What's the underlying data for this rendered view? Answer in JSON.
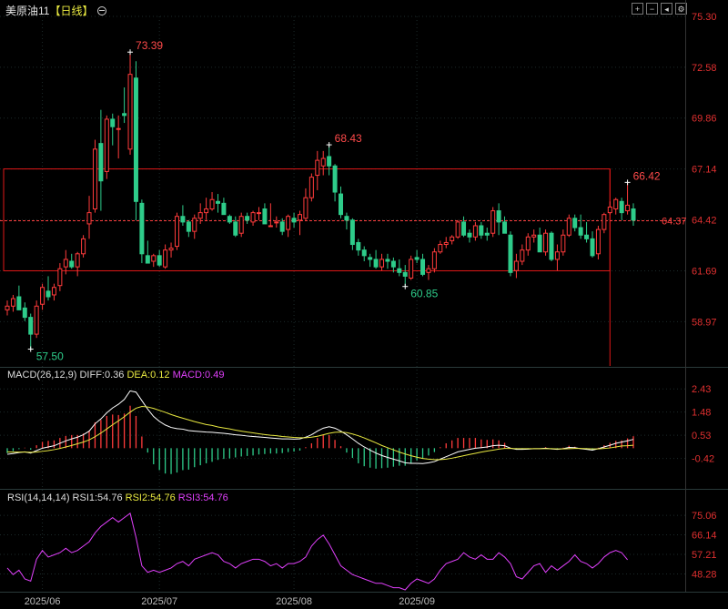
{
  "header": {
    "symbol": "美原油11",
    "period": "【日线】",
    "toggle_icon": "circle-minus-icon",
    "toolbar_icons": [
      "grid-plus-icon",
      "grid-minus-icon",
      "back-arrow-icon",
      "settings-icon"
    ]
  },
  "colors": {
    "up": "#ff3b3b",
    "down": "#2ecc8a",
    "ma_white": "#ffffff",
    "ma_yellow": "#e8e840",
    "rsi": "#e040fb",
    "box": "#e01818",
    "grid": "#1c2a2a"
  },
  "chart_data": [
    {
      "type": "candlestick",
      "title": "美原油11 【日线】",
      "y_ticks": [
        "75.30",
        "72.58",
        "69.86",
        "67.14",
        "64.42",
        "61.69",
        "58.97"
      ],
      "ylim": [
        56.6,
        75.3
      ],
      "x_ticks": [
        {
          "i": 6,
          "label": "2025/06"
        },
        {
          "i": 26,
          "label": "2025/07"
        },
        {
          "i": 49,
          "label": "2025/08"
        },
        {
          "i": 70,
          "label": "2025/09"
        }
      ],
      "ohlc": [
        [
          59.6,
          60.1,
          59.3,
          59.8
        ],
        [
          59.8,
          60.4,
          59.5,
          60.2
        ],
        [
          60.3,
          60.9,
          59.7,
          59.6
        ],
        [
          59.7,
          60.0,
          59.0,
          59.2
        ],
        [
          59.2,
          59.4,
          57.5,
          58.3
        ],
        [
          58.3,
          60.1,
          58.1,
          59.8
        ],
        [
          59.9,
          61.0,
          59.6,
          60.8
        ],
        [
          60.6,
          61.4,
          60.1,
          60.3
        ],
        [
          60.4,
          61.0,
          60.1,
          60.8
        ],
        [
          60.9,
          62.1,
          60.6,
          61.8
        ],
        [
          61.9,
          62.8,
          61.5,
          62.3
        ],
        [
          62.2,
          62.6,
          61.8,
          61.9
        ],
        [
          61.9,
          62.7,
          61.4,
          62.6
        ],
        [
          62.6,
          63.6,
          62.4,
          63.4
        ],
        [
          64.2,
          65.7,
          63.4,
          64.8
        ],
        [
          65.0,
          68.7,
          64.8,
          68.2
        ],
        [
          68.5,
          70.3,
          64.9,
          66.5
        ],
        [
          67.0,
          70.0,
          66.6,
          69.8
        ],
        [
          69.8,
          70.1,
          68.4,
          69.4
        ],
        [
          69.3,
          70.0,
          67.7,
          69.3
        ],
        [
          70.1,
          71.5,
          69.6,
          70.0
        ],
        [
          68.2,
          73.39,
          67.9,
          72.2
        ],
        [
          72.0,
          72.9,
          64.4,
          65.4
        ],
        [
          65.3,
          65.5,
          62.1,
          62.6
        ],
        [
          62.5,
          63.3,
          62.1,
          62.1
        ],
        [
          62.2,
          62.6,
          61.9,
          62.5
        ],
        [
          62.5,
          62.8,
          61.9,
          62.0
        ],
        [
          61.9,
          63.1,
          61.8,
          62.8
        ],
        [
          62.8,
          63.2,
          62.4,
          62.9
        ],
        [
          63.0,
          64.8,
          62.8,
          64.6
        ],
        [
          64.6,
          65.2,
          64.1,
          64.3
        ],
        [
          64.3,
          64.4,
          63.5,
          63.8
        ],
        [
          63.8,
          64.7,
          63.4,
          64.5
        ],
        [
          64.5,
          65.3,
          64.2,
          64.8
        ],
        [
          64.8,
          65.6,
          64.4,
          65.0
        ],
        [
          65.0,
          65.9,
          64.9,
          65.5
        ],
        [
          65.4,
          65.8,
          64.8,
          65.3
        ],
        [
          65.3,
          65.6,
          64.8,
          64.7
        ],
        [
          64.6,
          64.7,
          64.2,
          64.3
        ],
        [
          64.3,
          64.6,
          63.5,
          63.6
        ],
        [
          63.7,
          64.8,
          63.5,
          64.6
        ],
        [
          64.6,
          64.8,
          64.2,
          64.4
        ],
        [
          64.3,
          64.9,
          64.1,
          64.8
        ],
        [
          64.8,
          65.1,
          64.4,
          64.8
        ],
        [
          65.0,
          65.3,
          64.6,
          64.2
        ],
        [
          64.1,
          65.3,
          64.1,
          64.1
        ],
        [
          64.3,
          64.6,
          64.0,
          64.3
        ],
        [
          64.3,
          64.5,
          63.6,
          63.8
        ],
        [
          63.9,
          64.7,
          63.5,
          64.6
        ],
        [
          64.5,
          64.8,
          64.0,
          64.3
        ],
        [
          64.4,
          64.9,
          63.6,
          64.7
        ],
        [
          64.5,
          66.1,
          64.4,
          65.6
        ],
        [
          65.6,
          66.9,
          65.4,
          66.7
        ],
        [
          66.8,
          68.1,
          66.0,
          67.6
        ],
        [
          67.3,
          68.1,
          66.8,
          67.7
        ],
        [
          67.8,
          68.43,
          66.8,
          67.3
        ],
        [
          67.3,
          67.4,
          65.4,
          65.9
        ],
        [
          65.8,
          66.2,
          64.5,
          64.7
        ],
        [
          64.6,
          64.8,
          63.9,
          64.4
        ],
        [
          64.4,
          64.5,
          62.8,
          63.1
        ],
        [
          63.2,
          63.4,
          62.5,
          62.8
        ],
        [
          62.8,
          63.0,
          62.2,
          62.5
        ],
        [
          62.4,
          62.6,
          61.9,
          62.3
        ],
        [
          62.3,
          62.8,
          61.8,
          61.9
        ],
        [
          61.9,
          62.6,
          61.7,
          62.3
        ],
        [
          62.3,
          62.6,
          61.8,
          62.2
        ],
        [
          62.2,
          62.4,
          61.6,
          61.9
        ],
        [
          61.8,
          62.3,
          61.4,
          61.6
        ],
        [
          61.6,
          62.0,
          60.85,
          61.4
        ],
        [
          61.3,
          62.5,
          61.2,
          62.3
        ],
        [
          62.4,
          62.8,
          62.1,
          62.3
        ],
        [
          62.3,
          62.6,
          61.4,
          61.5
        ],
        [
          61.6,
          62.0,
          61.2,
          61.8
        ],
        [
          61.8,
          62.9,
          61.6,
          62.7
        ],
        [
          62.7,
          63.3,
          62.6,
          63.1
        ],
        [
          63.1,
          63.5,
          62.9,
          63.2
        ],
        [
          63.3,
          63.6,
          63.1,
          63.5
        ],
        [
          63.5,
          64.4,
          63.4,
          64.3
        ],
        [
          64.3,
          64.6,
          63.5,
          63.6
        ],
        [
          63.7,
          63.9,
          63.2,
          63.5
        ],
        [
          63.5,
          64.3,
          63.3,
          64.1
        ],
        [
          64.1,
          64.3,
          63.4,
          63.6
        ],
        [
          63.7,
          64.0,
          63.3,
          63.6
        ],
        [
          63.7,
          65.1,
          63.5,
          64.9
        ],
        [
          64.9,
          65.3,
          63.6,
          64.3
        ],
        [
          64.3,
          64.6,
          63.7,
          63.7
        ],
        [
          63.6,
          63.8,
          61.4,
          61.6
        ],
        [
          61.7,
          62.6,
          61.3,
          62.2
        ],
        [
          62.2,
          63.1,
          62.0,
          62.8
        ],
        [
          62.8,
          63.7,
          62.5,
          63.5
        ],
        [
          63.5,
          63.9,
          63.2,
          63.6
        ],
        [
          63.6,
          64.0,
          62.7,
          62.7
        ],
        [
          62.7,
          63.9,
          62.5,
          63.7
        ],
        [
          63.7,
          63.8,
          62.2,
          62.3
        ],
        [
          62.3,
          63.1,
          61.7,
          62.7
        ],
        [
          62.7,
          63.9,
          62.5,
          63.6
        ],
        [
          63.6,
          64.7,
          63.5,
          64.5
        ],
        [
          64.5,
          64.7,
          63.8,
          64.0
        ],
        [
          64.0,
          64.7,
          63.4,
          63.6
        ],
        [
          63.6,
          64.3,
          63.2,
          63.4
        ],
        [
          63.4,
          63.8,
          62.4,
          62.5
        ],
        [
          62.6,
          64.1,
          62.3,
          63.9
        ],
        [
          63.9,
          64.8,
          63.7,
          64.7
        ],
        [
          64.8,
          65.4,
          64.7,
          65.1
        ],
        [
          65.0,
          65.6,
          64.7,
          65.5
        ],
        [
          65.4,
          65.6,
          64.4,
          64.8
        ],
        [
          64.9,
          66.42,
          64.7,
          65.2
        ],
        [
          65.0,
          65.3,
          64.1,
          64.4
        ]
      ],
      "annotations": [
        {
          "label": "73.39",
          "i": 21,
          "v": 73.39,
          "kind": "high"
        },
        {
          "label": "57.50",
          "i": 4,
          "v": 57.5,
          "kind": "low"
        },
        {
          "label": "68.43",
          "i": 55,
          "v": 68.43,
          "kind": "high"
        },
        {
          "label": "60.85",
          "i": 68,
          "v": 60.85,
          "kind": "low"
        },
        {
          "label": "66.42",
          "i": 106,
          "v": 66.42,
          "kind": "high"
        }
      ],
      "last_price_label": "64.37",
      "last_price": 64.37,
      "box": {
        "i_start": 0,
        "i_end": 103,
        "top": 67.14,
        "bottom": 61.69,
        "vline_i": 103
      }
    },
    {
      "type": "macd",
      "legend": {
        "title": "MACD(26,12,9)",
        "diff": "DIFF:0.36",
        "dea": "DEA:0.12",
        "macd": "MACD:0.49"
      },
      "y_ticks": [
        "2.43",
        "1.48",
        "0.53",
        "-0.42"
      ],
      "ylim": [
        -1.63,
        2.7
      ],
      "diff": [
        -0.25,
        -0.22,
        -0.18,
        -0.15,
        -0.2,
        -0.1,
        0.0,
        0.05,
        0.1,
        0.2,
        0.3,
        0.38,
        0.45,
        0.55,
        0.7,
        1.0,
        1.2,
        1.45,
        1.65,
        1.8,
        2.0,
        2.35,
        2.3,
        1.95,
        1.6,
        1.3,
        1.1,
        0.95,
        0.85,
        0.8,
        0.78,
        0.72,
        0.7,
        0.68,
        0.66,
        0.65,
        0.63,
        0.61,
        0.58,
        0.55,
        0.53,
        0.5,
        0.48,
        0.46,
        0.44,
        0.42,
        0.4,
        0.38,
        0.38,
        0.37,
        0.38,
        0.45,
        0.55,
        0.7,
        0.82,
        0.88,
        0.82,
        0.7,
        0.55,
        0.38,
        0.2,
        0.05,
        -0.08,
        -0.2,
        -0.3,
        -0.38,
        -0.45,
        -0.52,
        -0.6,
        -0.62,
        -0.62,
        -0.63,
        -0.6,
        -0.55,
        -0.45,
        -0.35,
        -0.25,
        -0.15,
        -0.1,
        -0.05,
        0.0,
        0.02,
        0.05,
        0.1,
        0.12,
        0.1,
        0.0,
        -0.05,
        -0.05,
        -0.04,
        -0.02,
        -0.02,
        0.0,
        -0.03,
        -0.05,
        -0.02,
        0.03,
        0.02,
        -0.02,
        -0.05,
        -0.08,
        -0.02,
        0.05,
        0.12,
        0.2,
        0.25,
        0.3,
        0.36
      ],
      "dea": [
        -0.15,
        -0.16,
        -0.16,
        -0.16,
        -0.17,
        -0.16,
        -0.13,
        -0.1,
        -0.06,
        -0.01,
        0.05,
        0.11,
        0.18,
        0.25,
        0.34,
        0.47,
        0.62,
        0.79,
        0.96,
        1.12,
        1.29,
        1.48,
        1.64,
        1.71,
        1.69,
        1.63,
        1.55,
        1.47,
        1.38,
        1.3,
        1.23,
        1.16,
        1.09,
        1.03,
        0.97,
        0.93,
        0.87,
        0.83,
        0.79,
        0.74,
        0.7,
        0.66,
        0.63,
        0.59,
        0.56,
        0.53,
        0.51,
        0.48,
        0.46,
        0.44,
        0.43,
        0.43,
        0.45,
        0.49,
        0.55,
        0.61,
        0.65,
        0.66,
        0.64,
        0.58,
        0.51,
        0.42,
        0.32,
        0.22,
        0.11,
        0.02,
        -0.07,
        -0.16,
        -0.24,
        -0.31,
        -0.37,
        -0.42,
        -0.45,
        -0.47,
        -0.47,
        -0.45,
        -0.41,
        -0.36,
        -0.31,
        -0.26,
        -0.21,
        -0.16,
        -0.12,
        -0.08,
        -0.04,
        -0.01,
        -0.01,
        -0.02,
        -0.02,
        -0.02,
        -0.02,
        -0.02,
        -0.02,
        -0.02,
        -0.03,
        -0.03,
        -0.02,
        -0.01,
        -0.01,
        -0.02,
        -0.03,
        -0.03,
        -0.01,
        0.01,
        0.05,
        0.09,
        0.1,
        0.12
      ],
      "hist": [
        -0.2,
        -0.12,
        -0.04,
        0.02,
        -0.06,
        0.12,
        0.26,
        0.3,
        0.32,
        0.42,
        0.5,
        0.54,
        0.54,
        0.6,
        0.72,
        1.06,
        1.16,
        1.32,
        1.38,
        1.36,
        1.42,
        1.74,
        1.32,
        0.48,
        -0.18,
        -0.66,
        -0.9,
        -1.04,
        -1.06,
        -1.0,
        -0.9,
        -0.88,
        -0.78,
        -0.7,
        -0.62,
        -0.56,
        -0.48,
        -0.44,
        -0.42,
        -0.38,
        -0.34,
        -0.32,
        -0.3,
        -0.26,
        -0.24,
        -0.22,
        -0.22,
        -0.2,
        -0.16,
        -0.14,
        -0.1,
        0.04,
        0.2,
        0.42,
        0.54,
        0.54,
        0.34,
        0.08,
        -0.18,
        -0.4,
        -0.62,
        -0.74,
        -0.8,
        -0.84,
        -0.82,
        -0.8,
        -0.76,
        -0.72,
        -0.72,
        -0.62,
        -0.5,
        -0.42,
        -0.3,
        -0.16,
        0.04,
        0.2,
        0.32,
        0.42,
        0.42,
        0.42,
        0.42,
        0.36,
        0.34,
        0.36,
        0.32,
        0.22,
        0.02,
        -0.06,
        -0.06,
        -0.04,
        0.0,
        0.0,
        0.04,
        -0.02,
        -0.04,
        0.02,
        0.1,
        0.06,
        -0.02,
        -0.06,
        -0.1,
        0.02,
        0.12,
        0.22,
        0.3,
        0.32,
        0.4,
        0.49
      ]
    },
    {
      "type": "line",
      "legend": {
        "title": "RSI(14,14,14)",
        "rsi1": "RSI1:54.76",
        "rsi2": "RSI2:54.76",
        "rsi3": "RSI3:54.76"
      },
      "y_ticks": [
        "75.06",
        "66.14",
        "57.21",
        "48.28"
      ],
      "ylim": [
        41.0,
        80.5
      ],
      "values": [
        51,
        48,
        50,
        46,
        45,
        55,
        59,
        56,
        57,
        58,
        60,
        58,
        59,
        61,
        63,
        67,
        70,
        72,
        74,
        72,
        74,
        76,
        65,
        52,
        49,
        50,
        49,
        50,
        51,
        53,
        54,
        52,
        55,
        56,
        57,
        58,
        57,
        54,
        53,
        51,
        53,
        54,
        55,
        55,
        54,
        52,
        53,
        51,
        53,
        53,
        54,
        56,
        61,
        64,
        66,
        62,
        57,
        52,
        50,
        48,
        47,
        46,
        45,
        44,
        44,
        43,
        42,
        42,
        41,
        44,
        46,
        45,
        44,
        46,
        50,
        53,
        54,
        55,
        58,
        56,
        55,
        57,
        55,
        55,
        58,
        56,
        53,
        47,
        46,
        49,
        52,
        53,
        49,
        52,
        50,
        52,
        54,
        57,
        54,
        53,
        51,
        53,
        56,
        58,
        59,
        58,
        54.76
      ]
    }
  ]
}
